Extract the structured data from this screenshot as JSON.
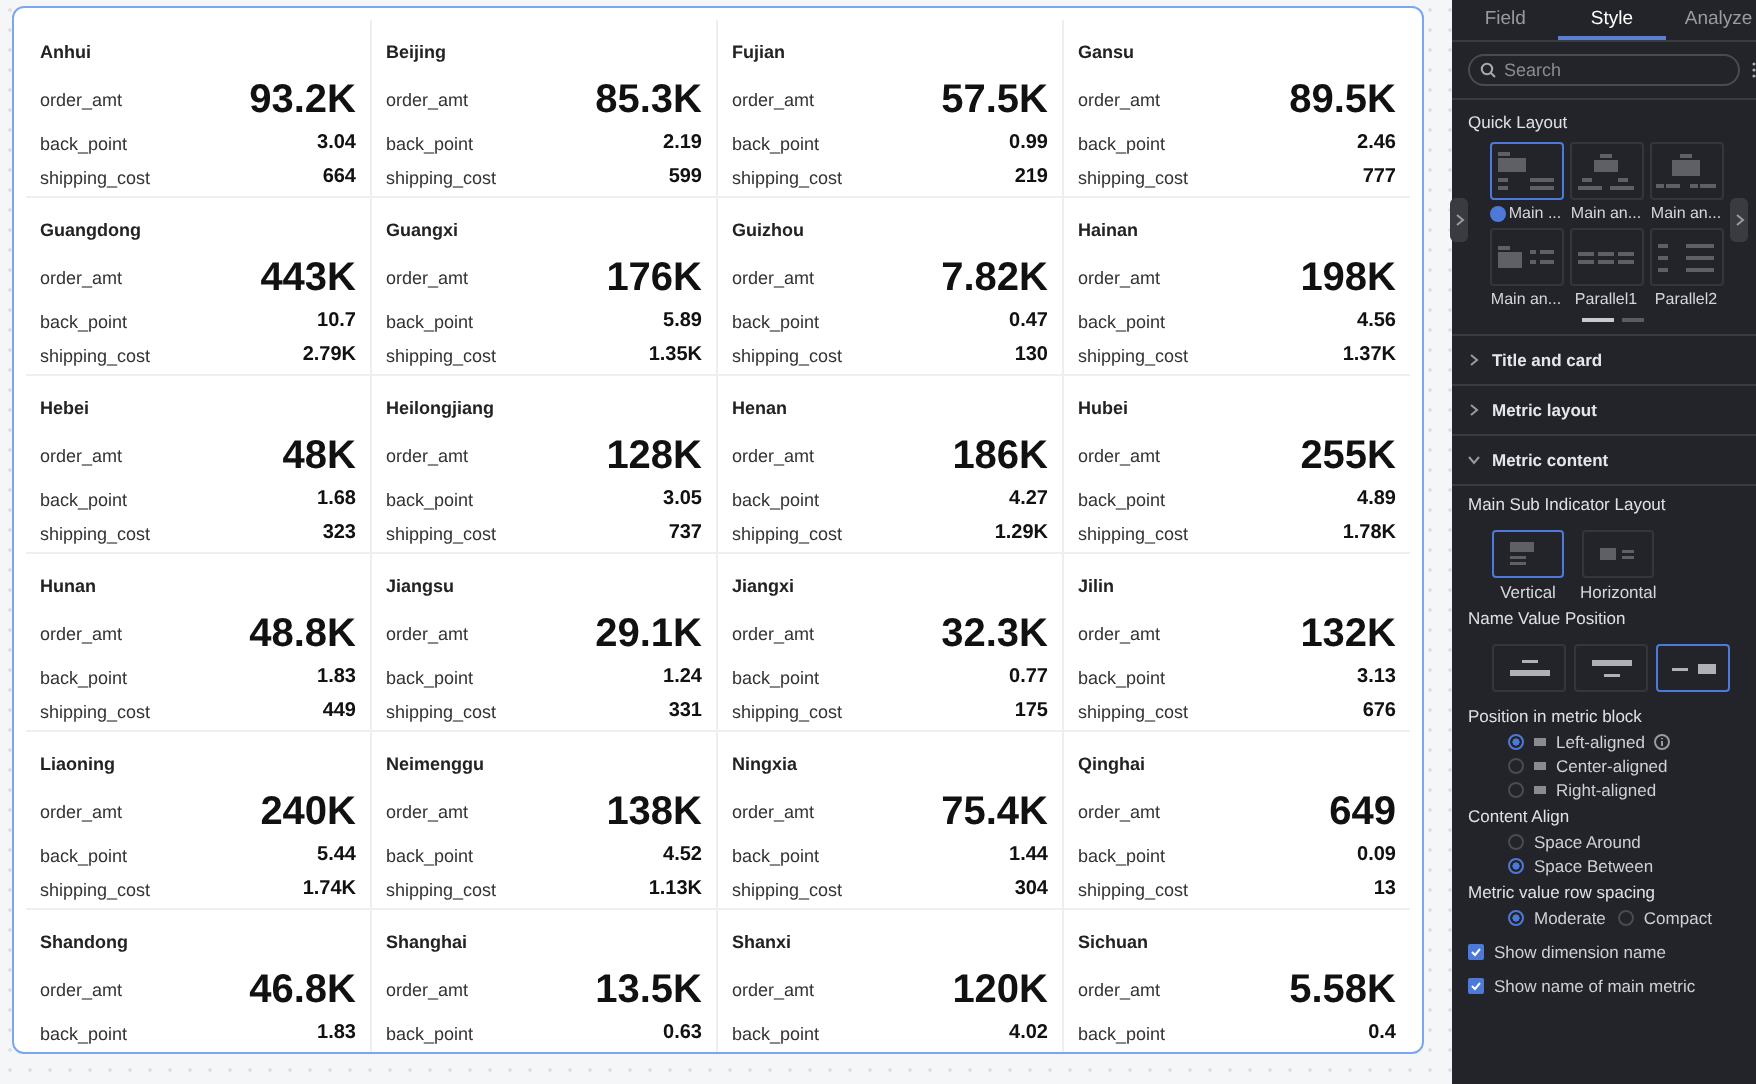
{
  "metrics": [
    {
      "name": "Anhui",
      "main": {
        "label": "order_amt",
        "value": "93.2K"
      },
      "rows": [
        {
          "label": "back_point",
          "value": "3.04"
        },
        {
          "label": "shipping_cost",
          "value": "664"
        }
      ]
    },
    {
      "name": "Beijing",
      "main": {
        "label": "order_amt",
        "value": "85.3K"
      },
      "rows": [
        {
          "label": "back_point",
          "value": "2.19"
        },
        {
          "label": "shipping_cost",
          "value": "599"
        }
      ]
    },
    {
      "name": "Fujian",
      "main": {
        "label": "order_amt",
        "value": "57.5K"
      },
      "rows": [
        {
          "label": "back_point",
          "value": "0.99"
        },
        {
          "label": "shipping_cost",
          "value": "219"
        }
      ]
    },
    {
      "name": "Gansu",
      "main": {
        "label": "order_amt",
        "value": "89.5K"
      },
      "rows": [
        {
          "label": "back_point",
          "value": "2.46"
        },
        {
          "label": "shipping_cost",
          "value": "777"
        }
      ]
    },
    {
      "name": "Guangdong",
      "main": {
        "label": "order_amt",
        "value": "443K"
      },
      "rows": [
        {
          "label": "back_point",
          "value": "10.7"
        },
        {
          "label": "shipping_cost",
          "value": "2.79K"
        }
      ]
    },
    {
      "name": "Guangxi",
      "main": {
        "label": "order_amt",
        "value": "176K"
      },
      "rows": [
        {
          "label": "back_point",
          "value": "5.89"
        },
        {
          "label": "shipping_cost",
          "value": "1.35K"
        }
      ]
    },
    {
      "name": "Guizhou",
      "main": {
        "label": "order_amt",
        "value": "7.82K"
      },
      "rows": [
        {
          "label": "back_point",
          "value": "0.47"
        },
        {
          "label": "shipping_cost",
          "value": "130"
        }
      ]
    },
    {
      "name": "Hainan",
      "main": {
        "label": "order_amt",
        "value": "198K"
      },
      "rows": [
        {
          "label": "back_point",
          "value": "4.56"
        },
        {
          "label": "shipping_cost",
          "value": "1.37K"
        }
      ]
    },
    {
      "name": "Hebei",
      "main": {
        "label": "order_amt",
        "value": "48K"
      },
      "rows": [
        {
          "label": "back_point",
          "value": "1.68"
        },
        {
          "label": "shipping_cost",
          "value": "323"
        }
      ]
    },
    {
      "name": "Heilongjiang",
      "main": {
        "label": "order_amt",
        "value": "128K"
      },
      "rows": [
        {
          "label": "back_point",
          "value": "3.05"
        },
        {
          "label": "shipping_cost",
          "value": "737"
        }
      ]
    },
    {
      "name": "Henan",
      "main": {
        "label": "order_amt",
        "value": "186K"
      },
      "rows": [
        {
          "label": "back_point",
          "value": "4.27"
        },
        {
          "label": "shipping_cost",
          "value": "1.29K"
        }
      ]
    },
    {
      "name": "Hubei",
      "main": {
        "label": "order_amt",
        "value": "255K"
      },
      "rows": [
        {
          "label": "back_point",
          "value": "4.89"
        },
        {
          "label": "shipping_cost",
          "value": "1.78K"
        }
      ]
    },
    {
      "name": "Hunan",
      "main": {
        "label": "order_amt",
        "value": "48.8K"
      },
      "rows": [
        {
          "label": "back_point",
          "value": "1.83"
        },
        {
          "label": "shipping_cost",
          "value": "449"
        }
      ]
    },
    {
      "name": "Jiangsu",
      "main": {
        "label": "order_amt",
        "value": "29.1K"
      },
      "rows": [
        {
          "label": "back_point",
          "value": "1.24"
        },
        {
          "label": "shipping_cost",
          "value": "331"
        }
      ]
    },
    {
      "name": "Jiangxi",
      "main": {
        "label": "order_amt",
        "value": "32.3K"
      },
      "rows": [
        {
          "label": "back_point",
          "value": "0.77"
        },
        {
          "label": "shipping_cost",
          "value": "175"
        }
      ]
    },
    {
      "name": "Jilin",
      "main": {
        "label": "order_amt",
        "value": "132K"
      },
      "rows": [
        {
          "label": "back_point",
          "value": "3.13"
        },
        {
          "label": "shipping_cost",
          "value": "676"
        }
      ]
    },
    {
      "name": "Liaoning",
      "main": {
        "label": "order_amt",
        "value": "240K"
      },
      "rows": [
        {
          "label": "back_point",
          "value": "5.44"
        },
        {
          "label": "shipping_cost",
          "value": "1.74K"
        }
      ]
    },
    {
      "name": "Neimenggu",
      "main": {
        "label": "order_amt",
        "value": "138K"
      },
      "rows": [
        {
          "label": "back_point",
          "value": "4.52"
        },
        {
          "label": "shipping_cost",
          "value": "1.13K"
        }
      ]
    },
    {
      "name": "Ningxia",
      "main": {
        "label": "order_amt",
        "value": "75.4K"
      },
      "rows": [
        {
          "label": "back_point",
          "value": "1.44"
        },
        {
          "label": "shipping_cost",
          "value": "304"
        }
      ]
    },
    {
      "name": "Qinghai",
      "main": {
        "label": "order_amt",
        "value": "649"
      },
      "rows": [
        {
          "label": "back_point",
          "value": "0.09"
        },
        {
          "label": "shipping_cost",
          "value": "13"
        }
      ]
    },
    {
      "name": "Shandong",
      "main": {
        "label": "order_amt",
        "value": "46.8K"
      },
      "rows": [
        {
          "label": "back_point",
          "value": "1.83"
        }
      ]
    },
    {
      "name": "Shanghai",
      "main": {
        "label": "order_amt",
        "value": "13.5K"
      },
      "rows": [
        {
          "label": "back_point",
          "value": "0.63"
        }
      ]
    },
    {
      "name": "Shanxi",
      "main": {
        "label": "order_amt",
        "value": "120K"
      },
      "rows": [
        {
          "label": "back_point",
          "value": "4.02"
        }
      ]
    },
    {
      "name": "Sichuan",
      "main": {
        "label": "order_amt",
        "value": "5.58K"
      },
      "rows": [
        {
          "label": "back_point",
          "value": "0.4"
        }
      ]
    }
  ],
  "panel": {
    "tabs": [
      {
        "label": "Field",
        "selected": false
      },
      {
        "label": "Style",
        "selected": true
      },
      {
        "label": "Analyze",
        "selected": false
      }
    ],
    "search": {
      "placeholder": "Search"
    },
    "quick_layout": {
      "title": "Quick Layout",
      "items": [
        {
          "label": "Main ...",
          "kind": "main-left",
          "selected": true,
          "badge": true
        },
        {
          "label": "Main an...",
          "kind": "main-center",
          "selected": false,
          "badge": false
        },
        {
          "label": "Main an...",
          "kind": "main-top",
          "selected": false,
          "badge": false
        },
        {
          "label": "Main an...",
          "kind": "main-side",
          "selected": false,
          "badge": false
        },
        {
          "label": "Parallel1",
          "kind": "parallel-row",
          "selected": false,
          "badge": false
        },
        {
          "label": "Parallel2",
          "kind": "parallel-col",
          "selected": false,
          "badge": false
        }
      ],
      "pages": [
        {
          "selected": true
        },
        {
          "selected": false
        }
      ]
    },
    "sections": [
      {
        "title": "Title and card",
        "expanded": false
      },
      {
        "title": "Metric layout",
        "expanded": false
      },
      {
        "title": "Metric content",
        "expanded": true
      }
    ],
    "metric_content": {
      "indicator_layout": {
        "title": "Main Sub Indicator Layout",
        "options": [
          {
            "label": "Vertical",
            "kind": "vertical",
            "selected": true
          },
          {
            "label": "Horizontal",
            "kind": "horizontal",
            "selected": false
          }
        ]
      },
      "name_value_position": {
        "title": "Name Value Position",
        "options": [
          {
            "kind": "name-above",
            "selected": false
          },
          {
            "kind": "name-below",
            "selected": false
          },
          {
            "kind": "inline",
            "selected": true
          }
        ]
      },
      "position": {
        "title": "Position in metric block",
        "options": [
          {
            "label": "Left-aligned",
            "selected": true,
            "info": true
          },
          {
            "label": "Center-aligned",
            "selected": false,
            "info": false
          },
          {
            "label": "Right-aligned",
            "selected": false,
            "info": false
          }
        ]
      },
      "content_align": {
        "title": "Content Align",
        "options": [
          {
            "label": "Space Around",
            "selected": false
          },
          {
            "label": "Space Between",
            "selected": true
          }
        ]
      },
      "row_spacing": {
        "title": "Metric value row spacing",
        "options": [
          {
            "label": "Moderate",
            "selected": true
          },
          {
            "label": "Compact",
            "selected": false
          }
        ]
      },
      "checkboxes": [
        {
          "label": "Show dimension name",
          "checked": true
        },
        {
          "label": "Show name of main metric",
          "checked": true
        }
      ]
    }
  }
}
